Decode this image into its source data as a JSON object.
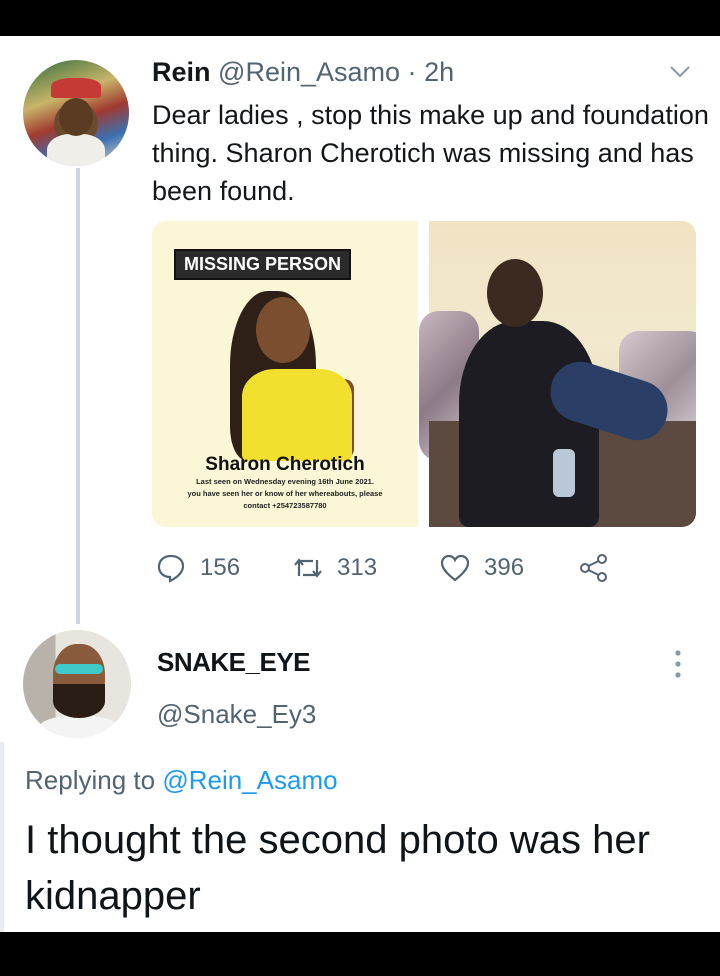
{
  "tweet": {
    "author_name": "Rein",
    "author_handle": "@Rein_Asamo",
    "separator": "·",
    "time": "2h",
    "text": "Dear ladies , stop this make up and foundation thing. Sharon Cherotich was missing and has been found.",
    "media": {
      "poster": {
        "tag": "MISSING PERSON",
        "name": "Sharon Cherotich",
        "line1": "Last seen on Wednesday evening 16th June 2021.",
        "line2": "you have seen her or know of her whereabouts, please",
        "line3": "contact +254723587780"
      }
    },
    "actions": {
      "replies": "156",
      "retweets": "313",
      "likes": "396"
    }
  },
  "reply": {
    "author_name": "SNAKE_EYE",
    "author_handle": "@Snake_Ey3",
    "replying_prefix": "Replying to ",
    "replying_to": "@Rein_Asamo",
    "text": "I thought the second photo was her kidnapper"
  },
  "colors": {
    "accent": "#1d9bf0",
    "secondary_text": "#536471",
    "thread_line": "#c9d6e3"
  },
  "icons": {
    "menu": "chevron-down-icon",
    "reply": "reply-bubble-icon",
    "retweet": "retweet-icon",
    "like": "heart-icon",
    "share": "share-icon",
    "more": "more-vertical-icon"
  }
}
